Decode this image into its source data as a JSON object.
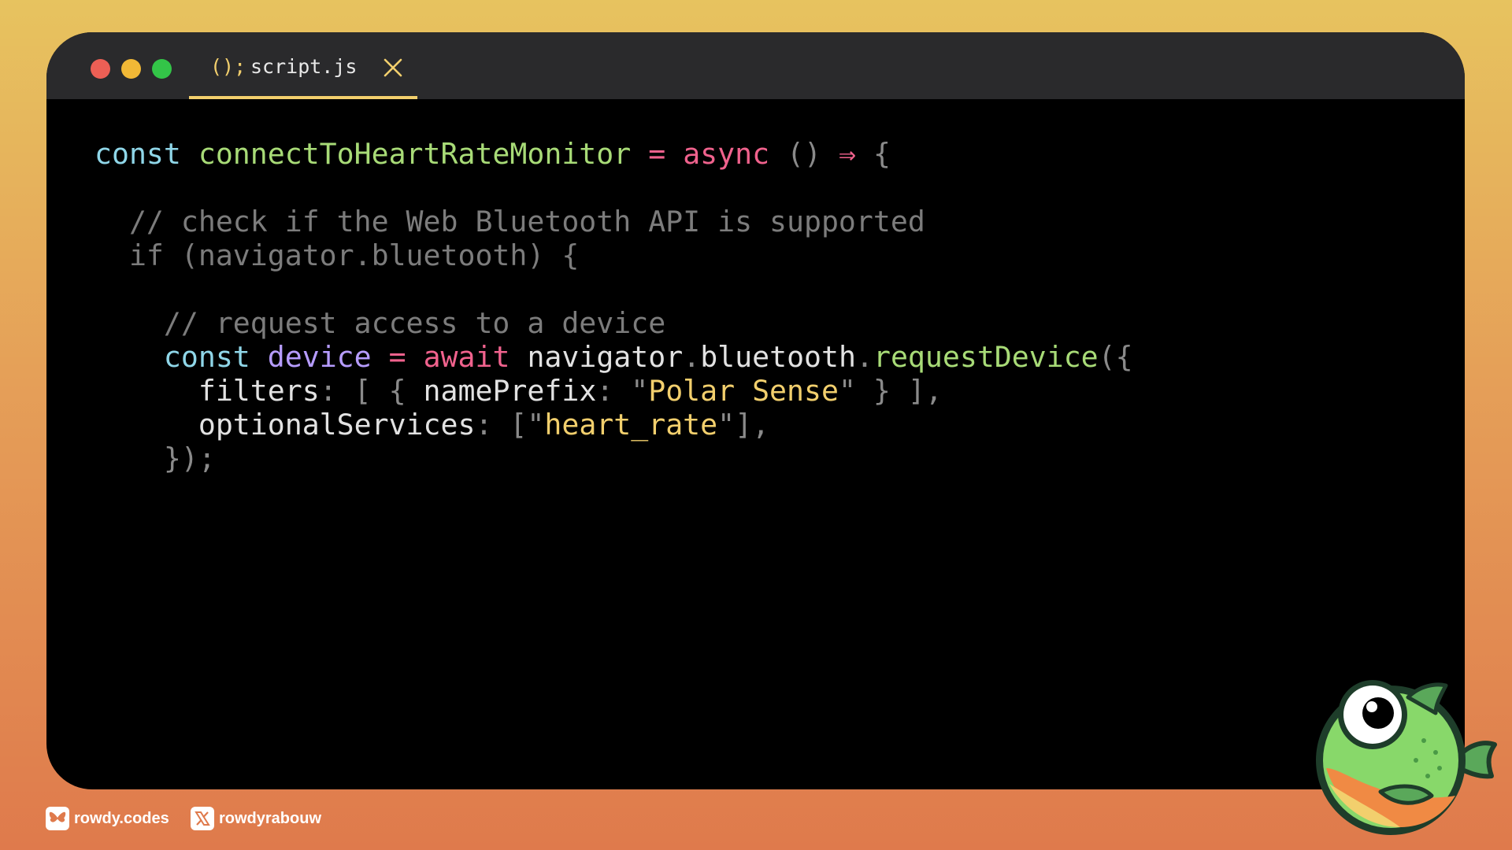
{
  "window": {
    "tab_icon": "();",
    "tab_label": "script.js",
    "tab_close_icon": "close-icon"
  },
  "code_lines": [
    [
      [
        "const",
        "kw"
      ],
      [
        " ",
        "pl"
      ],
      [
        "connectToHeartRateMonitor",
        "fn"
      ],
      [
        " ",
        "pl"
      ],
      [
        "=",
        "op"
      ],
      [
        " ",
        "pl"
      ],
      [
        "async",
        "op"
      ],
      [
        " ",
        "pl"
      ],
      [
        "()",
        "punc"
      ],
      [
        " ",
        "pl"
      ],
      [
        "⇒",
        "op"
      ],
      [
        " ",
        "pl"
      ],
      [
        "{",
        "punc"
      ]
    ],
    [],
    [
      [
        "  ",
        "pl"
      ],
      [
        "// check if the Web Bluetooth API is supported",
        "cm"
      ]
    ],
    [
      [
        "  ",
        "pl"
      ],
      [
        "if (navigator.bluetooth) {",
        "cm"
      ]
    ],
    [],
    [
      [
        "    ",
        "pl"
      ],
      [
        "// request access to a device",
        "cm"
      ]
    ],
    [
      [
        "    ",
        "pl"
      ],
      [
        "const",
        "kw"
      ],
      [
        " ",
        "pl"
      ],
      [
        "device",
        "var"
      ],
      [
        " ",
        "pl"
      ],
      [
        "=",
        "op"
      ],
      [
        " ",
        "pl"
      ],
      [
        "await",
        "op"
      ],
      [
        " ",
        "pl"
      ],
      [
        "navigator",
        "pl"
      ],
      [
        ".",
        "punc"
      ],
      [
        "bluetooth",
        "pl"
      ],
      [
        ".",
        "punc"
      ],
      [
        "requestDevice",
        "fn"
      ],
      [
        "({",
        "punc"
      ]
    ],
    [
      [
        "      ",
        "pl"
      ],
      [
        "filters",
        "pl"
      ],
      [
        ": [ { ",
        "punc"
      ],
      [
        "namePrefix",
        "pl"
      ],
      [
        ": \"",
        "punc"
      ],
      [
        "Polar Sense",
        "str"
      ],
      [
        "\" } ],",
        "punc"
      ]
    ],
    [
      [
        "      ",
        "pl"
      ],
      [
        "optionalServices",
        "pl"
      ],
      [
        ": [\"",
        "punc"
      ],
      [
        "heart_rate",
        "str"
      ],
      [
        "\"],",
        "punc"
      ]
    ],
    [
      [
        "    ",
        "pl"
      ],
      [
        "});",
        "punc"
      ]
    ]
  ],
  "footer": {
    "bluesky_handle": "rowdy.codes",
    "bluesky_icon": "butterfly-icon",
    "x_handle": "rowdyrabouw",
    "x_icon": "x-logo-icon"
  },
  "mascot_icon": "fish-mascot-icon",
  "colors": {
    "keyword": "#8fd6e8",
    "function": "#a8db77",
    "operator": "#f0628d",
    "comment": "#7c7c7c",
    "variable": "#b69cff",
    "string": "#f2cf6d",
    "tab_accent": "#f2cf6d"
  }
}
